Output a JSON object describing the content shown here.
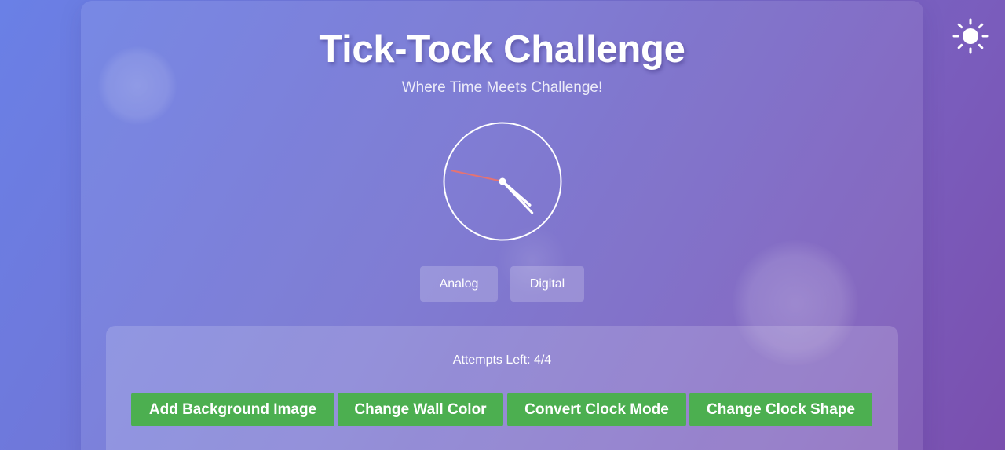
{
  "header": {
    "title": "Tick-Tock Challenge",
    "subtitle": "Where Time Meets Challenge!"
  },
  "theme_toggle": {
    "icon": "sun-icon"
  },
  "clock": {
    "mode": "analog",
    "shape": "circle",
    "face_color": "transparent",
    "outline_color": "#ffffff",
    "hand_color": "#ffffff",
    "second_hand_color": "#e57373",
    "time": {
      "hours": 4,
      "minutes": 22,
      "seconds": 47
    }
  },
  "mode_switch": {
    "analog_label": "Analog",
    "digital_label": "Digital"
  },
  "controls": {
    "attempts_text": "Attempts Left: 4/4",
    "buttons": [
      {
        "label": "Add Background Image"
      },
      {
        "label": "Change Wall Color"
      },
      {
        "label": "Convert Clock Mode"
      },
      {
        "label": "Change Clock Shape"
      }
    ]
  },
  "colors": {
    "action_button": "#4caf50",
    "gradient_start": "#6a80e6",
    "gradient_end": "#7a4fae"
  }
}
